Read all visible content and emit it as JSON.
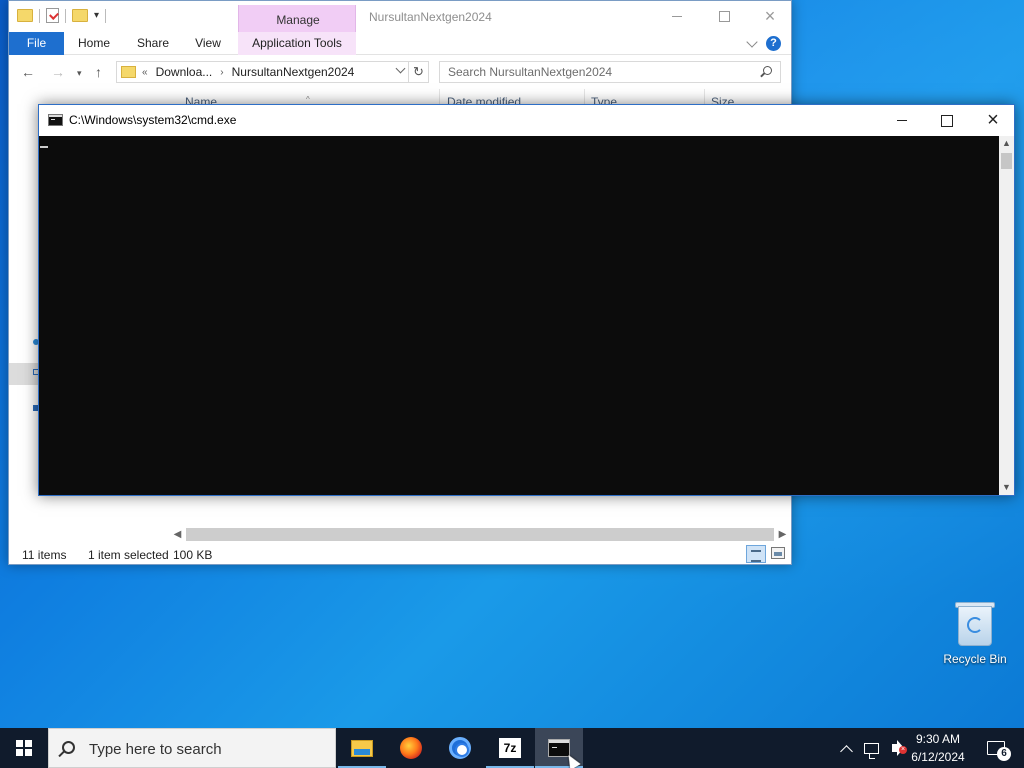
{
  "explorer": {
    "title": "NursultanNextgen2024",
    "context_tab_group": "Manage",
    "tabs": [
      "File",
      "Home",
      "Share",
      "View",
      "Application Tools"
    ],
    "help_label": "?",
    "address": {
      "overflow": "«",
      "crumbs": [
        "Downloa...",
        "NursultanNextgen2024"
      ],
      "separator": "›"
    },
    "search_placeholder": "Search NursultanNextgen2024",
    "columns": [
      "Name",
      "Date modified",
      "Type",
      "Size"
    ],
    "status": {
      "item_count": "11 items",
      "selected": "1 item selected",
      "size": "100 KB"
    }
  },
  "cmd": {
    "title": "C:\\Windows\\system32\\cmd.exe",
    "content": ""
  },
  "desktop": {
    "recycle_bin_label": "Recycle Bin"
  },
  "taskbar": {
    "search_placeholder": "Type here to search",
    "apps": [
      {
        "icon": "file-explorer-icon",
        "state": "running"
      },
      {
        "icon": "firefox-icon",
        "state": "pinned"
      },
      {
        "icon": "chrome-icon",
        "state": "pinned"
      },
      {
        "icon": "7zip-icon",
        "state": "running"
      },
      {
        "icon": "cmd-icon",
        "state": "active"
      }
    ],
    "clock": {
      "time": "9:30 AM",
      "date": "6/12/2024"
    },
    "notification_count": "6"
  },
  "colors": {
    "file_tab": "#1e6fcf",
    "manage_tab": "#f1cdf5",
    "cmd_background": "#0c0c0c",
    "taskbar": "#101b2c"
  }
}
